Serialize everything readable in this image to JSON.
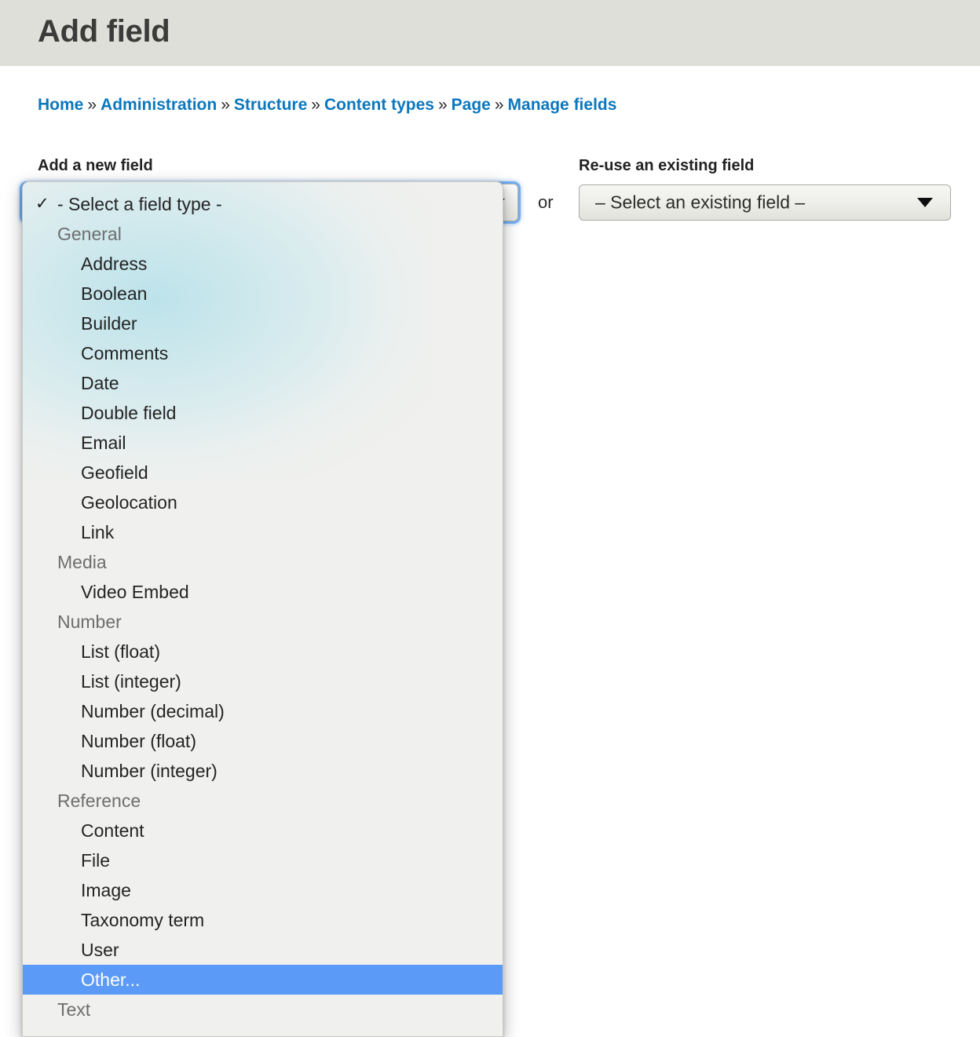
{
  "header": {
    "title": "Add field",
    "background": "#dedfd9"
  },
  "breadcrumb": {
    "separator": "»",
    "items": [
      {
        "label": "Home"
      },
      {
        "label": "Administration"
      },
      {
        "label": "Structure"
      },
      {
        "label": "Content types"
      },
      {
        "label": "Page"
      },
      {
        "label": "Manage fields"
      }
    ],
    "link_color": "#0c77bd"
  },
  "form": {
    "new_field_label": "Add a new field",
    "reuse_field_label": "Re-use an existing field",
    "or_text": "or",
    "reuse_field_value": "– Select an existing field –",
    "new_field_value": "- Select a field type -",
    "arrow_icon": "chevron-down-icon"
  },
  "dropdown": {
    "check_glyph": "✓",
    "highlight_color": "#5b9af6",
    "background": "#f0f0ee",
    "options": [
      {
        "label": "- Select a field type -",
        "kind": "selected",
        "checked": true
      },
      {
        "label": "General",
        "kind": "group"
      },
      {
        "label": "Address",
        "kind": "item"
      },
      {
        "label": "Boolean",
        "kind": "item"
      },
      {
        "label": "Builder",
        "kind": "item"
      },
      {
        "label": "Comments",
        "kind": "item"
      },
      {
        "label": "Date",
        "kind": "item"
      },
      {
        "label": "Double field",
        "kind": "item"
      },
      {
        "label": "Email",
        "kind": "item"
      },
      {
        "label": "Geofield",
        "kind": "item"
      },
      {
        "label": "Geolocation",
        "kind": "item"
      },
      {
        "label": "Link",
        "kind": "item"
      },
      {
        "label": "Media",
        "kind": "group"
      },
      {
        "label": "Video Embed",
        "kind": "item"
      },
      {
        "label": "Number",
        "kind": "group"
      },
      {
        "label": "List (float)",
        "kind": "item"
      },
      {
        "label": "List (integer)",
        "kind": "item"
      },
      {
        "label": "Number (decimal)",
        "kind": "item"
      },
      {
        "label": "Number (float)",
        "kind": "item"
      },
      {
        "label": "Number (integer)",
        "kind": "item"
      },
      {
        "label": "Reference",
        "kind": "group"
      },
      {
        "label": "Content",
        "kind": "item"
      },
      {
        "label": "File",
        "kind": "item"
      },
      {
        "label": "Image",
        "kind": "item"
      },
      {
        "label": "Taxonomy term",
        "kind": "item"
      },
      {
        "label": "User",
        "kind": "item"
      },
      {
        "label": "Other...",
        "kind": "item",
        "highlighted": true
      },
      {
        "label": "Text",
        "kind": "group"
      }
    ]
  }
}
